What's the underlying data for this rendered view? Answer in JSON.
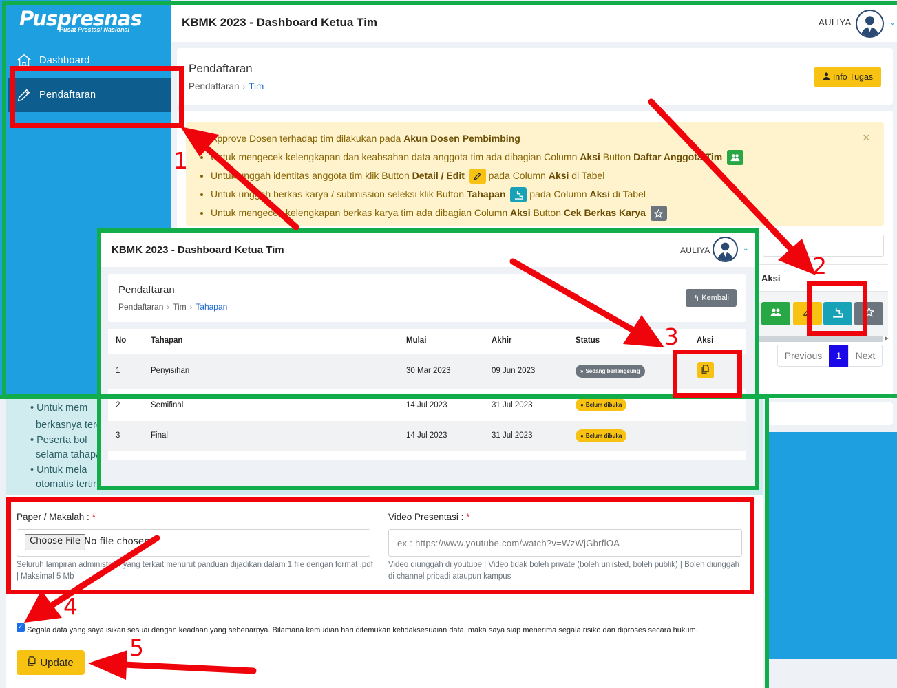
{
  "sidebar": {
    "logo_text": "Puspresnas",
    "logo_sub": "Pusat Prestasi Nasional",
    "items": [
      {
        "label": "Dashboard",
        "icon": "home-icon"
      },
      {
        "label": "Pendaftaran",
        "icon": "pencil-icon"
      }
    ]
  },
  "header": {
    "title": "KBMK 2023 - Dashboard Ketua Tim",
    "user": "AULIYA"
  },
  "page": {
    "title": "Pendaftaran",
    "breadcrumb": [
      "Pendaftaran",
      "Tim"
    ],
    "info_button": "Info Tugas"
  },
  "alert": {
    "close": "×",
    "items": [
      {
        "pre": "Approve Dosen terhadap tim dilakukan pada ",
        "bold1": "Akun Dosen Pembimbing",
        "mid": "",
        "bold2": "",
        "post": ""
      },
      {
        "pre": "Untuk mengecek kelengkapan dan keabsahan data anggota tim ada dibagian Column ",
        "bold1": "Aksi",
        "mid": " Button ",
        "bold2": "Daftar Anggota Tim",
        "post": ""
      },
      {
        "pre": "Untuk unggah identitas anggota tim klik Button ",
        "bold1": "Detail / Edit",
        "mid": "",
        "bold2": "",
        "post": " pada Column ",
        "bold3": "Aksi",
        "post2": " di Tabel"
      },
      {
        "pre": "Untuk unggah berkas karya / submission seleksi klik Button ",
        "bold1": "Tahapan",
        "mid": "",
        "bold2": "",
        "post": " pada Column ",
        "bold3": "Aksi",
        "post2": " di Tabel"
      },
      {
        "pre": "Untuk mengecek kelengkapan berkas karya tim ada dibagian Column ",
        "bold1": "Aksi",
        "mid": " Button ",
        "bold2": "Cek Berkas Karya",
        "post": ""
      }
    ]
  },
  "table_main": {
    "aksi_header": "Aksi",
    "pagination": {
      "previous": "Previous",
      "current": "1",
      "next": "Next"
    }
  },
  "tahapan": {
    "title": "Pendaftaran",
    "breadcrumb": [
      "Pendaftaran",
      "Tim",
      "Tahapan"
    ],
    "back_button": "Kembali",
    "columns": [
      "No",
      "Tahapan",
      "Mulai",
      "Akhir",
      "Status",
      "Aksi"
    ],
    "rows": [
      {
        "no": "1",
        "tahapan": "Penyisihan",
        "mulai": "30 Mar 2023",
        "akhir": "09 Jun 2023",
        "status": "Sedang berlangsung",
        "status_type": "running"
      },
      {
        "no": "2",
        "tahapan": "Semifinal",
        "mulai": "14 Jul 2023",
        "akhir": "31 Jul 2023",
        "status": "Belum dibuka",
        "status_type": "closed"
      },
      {
        "no": "3",
        "tahapan": "Final",
        "mulai": "14 Jul 2023",
        "akhir": "31 Jul 2023",
        "status": "Belum dibuka",
        "status_type": "closed"
      }
    ]
  },
  "form": {
    "instructions": [
      "•  Untuk mem",
      "berkasnya terc",
      "•  Peserta bol",
      "selama tahapa",
      "•  Untuk mela",
      "otomatis tertir"
    ],
    "paper_label": "Paper / Makalah :",
    "required_mark": "*",
    "choose_file": "Choose File",
    "no_file": "No file chosen",
    "paper_help": "Seluruh lampiran administrasi yang terkait menurut panduan dijadikan dalam 1 file dengan format .pdf | Maksimal 5 Mb",
    "video_label": "Video Presentasi :",
    "video_placeholder": "ex : https://www.youtube.com/watch?v=WzWjGbrflOA",
    "video_help": "Video diunggah di youtube | Video tidak boleh private (boleh unlisted, boleh publik) | Boleh diunggah di channel pribadi ataupun kampus",
    "agreement": "Segala data yang saya isikan sesuai dengan keadaan yang sebenarnya. Bilamana kemudian hari ditemukan ketidaksesuaian data, maka saya siap menerima segala risiko dan diproses secara hukum.",
    "update_button": "Update"
  },
  "annotations": {
    "steps": [
      "1",
      "2",
      "3",
      "4",
      "5"
    ]
  },
  "colors": {
    "sidebar_blue": "#1e9fe0",
    "sidebar_active": "#0d5e8e",
    "warning_yellow": "#f7c212",
    "success_green": "#28a745",
    "info_teal": "#17a2b8",
    "secondary_gray": "#6c757d",
    "pager_active": "#1a08e8",
    "annotation_red": "#f0040c",
    "annotation_green": "#12ad4b"
  }
}
